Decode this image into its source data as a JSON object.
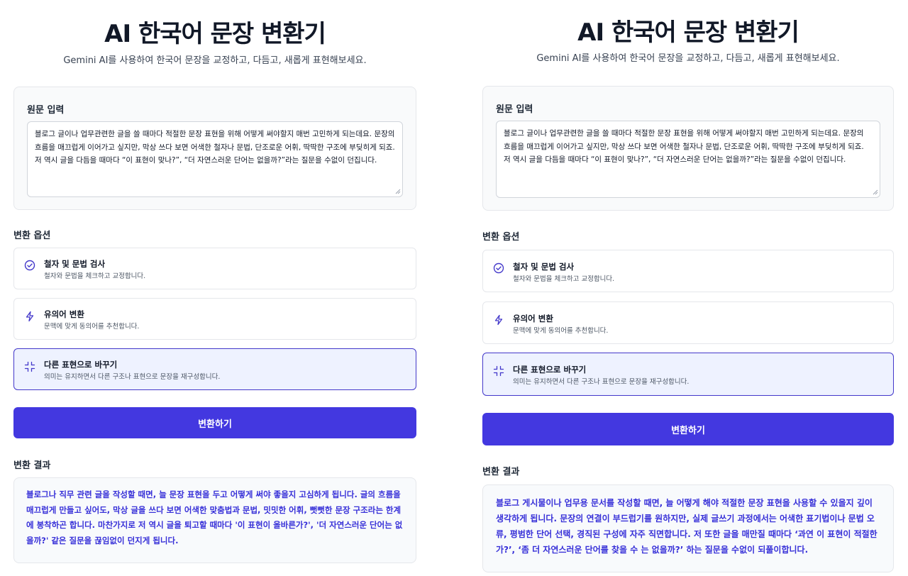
{
  "colors": {
    "accent": "#4338e0",
    "result_text": "#3730d8",
    "selected_bg": "#eef2ff"
  },
  "left": {
    "header": {
      "title": "AI 한국어 문장 변환기",
      "subtitle": "Gemini AI를 사용하여 한국어 문장을 교정하고, 다듬고, 새롭게 표현해보세요."
    },
    "input": {
      "label": "원문 입력",
      "value": "블로그 글이나 업무관련한 글을 쓸 때마다 적절한 문장 표현을 위해 어떻게 써야할지 매번 고민하게 되는데요. 문장의 흐름을 매끄럽게 이어가고 싶지만, 막상 쓰다 보면 어색한 철자나 문법, 단조로운 어휘, 딱딱한 구조에 부딪히게 되죠. 저 역시 글을 다듬을 때마다 “이 표현이 맞나?”, “더 자연스러운 단어는 없을까?”라는 질문을 수없이 던집니다."
    },
    "options": {
      "label": "변환 옵션",
      "items": [
        {
          "title": "철자 및 문법 검사",
          "desc": "철자와 문법을 체크하고 교정합니다.",
          "icon": "check-circle-icon",
          "selected": false
        },
        {
          "title": "유의어 변환",
          "desc": "문맥에 맞게 동의어를 추천합니다.",
          "icon": "lightning-icon",
          "selected": false
        },
        {
          "title": "다른 표현으로 바꾸기",
          "desc": "의미는 유지하면서 다른 구조나 표현으로 문장을 재구성합니다.",
          "icon": "minimize-arrows-icon",
          "selected": true
        }
      ]
    },
    "convert_label": "변환하기",
    "result": {
      "label": "변환 결과",
      "text": "블로그나 직무 관련 글을 작성할 때면, 늘 문장 표현을 두고 어떻게 써야 좋을지 고심하게 됩니다. 글의 흐름을 매끄럽게 만들고 싶어도, 막상 글을 쓰다 보면 어색한 맞춤법과 문법, 밋밋한 어휘, 뻣뻣한 문장 구조라는 한계에 봉착하곤 합니다. 마찬가지로 저 역시 글을 퇴고할 때마다 '이 표현이 올바른가?', '더 자연스러운 단어는 없을까?' 같은 질문을 끊임없이 던지게 됩니다."
    }
  },
  "right": {
    "header": {
      "title": "AI 한국어 문장 변환기",
      "subtitle": "Gemini AI를 사용하여 한국어 문장을 교정하고, 다듬고, 새롭게 표현해보세요."
    },
    "input": {
      "label": "원문 입력",
      "value": "블로그 글이나 업무관련한 글을 쓸 때마다 적절한 문장 표현을 위해 어떻게 써야할지 매번 고민하게 되는데요. 문장의 흐름을 매끄럽게 이어가고 싶지만, 막상 쓰다 보면 어색한 철자나 문법, 단조로운 어휘, 딱딱한 구조에 부딪히게 되죠. 저 역시 글을 다듬을 때마다 “이 표현이 맞나?”, “더 자연스러운 단어는 없을까?”라는 질문을 수없이 던집니다."
    },
    "options": {
      "label": "변환 옵션",
      "items": [
        {
          "title": "철자 및 문법 검사",
          "desc": "철자와 문법을 체크하고 교정합니다.",
          "icon": "check-circle-icon",
          "selected": false
        },
        {
          "title": "유의어 변환",
          "desc": "문맥에 맞게 동의어를 추천합니다.",
          "icon": "lightning-icon",
          "selected": false
        },
        {
          "title": "다른 표현으로 바꾸기",
          "desc": "의미는 유지하면서 다른 구조나 표현으로 문장을 재구성합니다.",
          "icon": "minimize-arrows-icon",
          "selected": true
        }
      ]
    },
    "convert_label": "변환하기",
    "result": {
      "label": "변환 결과",
      "text": "블로그 게시물이나 업무용 문서를 작성할 때면, 늘 어떻게 해야 적절한 문장 표현을 사용할 수 있을지 깊이 생각하게 됩니다. 문장의 연결이 부드럽기를 원하지만, 실제 글쓰기 과정에서는 어색한 표기법이나 문법 오류, 평범한 단어 선택, 경직된 구성에 자주 직면합니다. 저 또한 글을 매만질 때마다 ‘과연 이 표현이 적절한가?’, ‘좀 더 자연스러운 단어를 찾을 수 는 없을까?’ 하는 질문을 수없이 되풀이합니다."
    }
  }
}
